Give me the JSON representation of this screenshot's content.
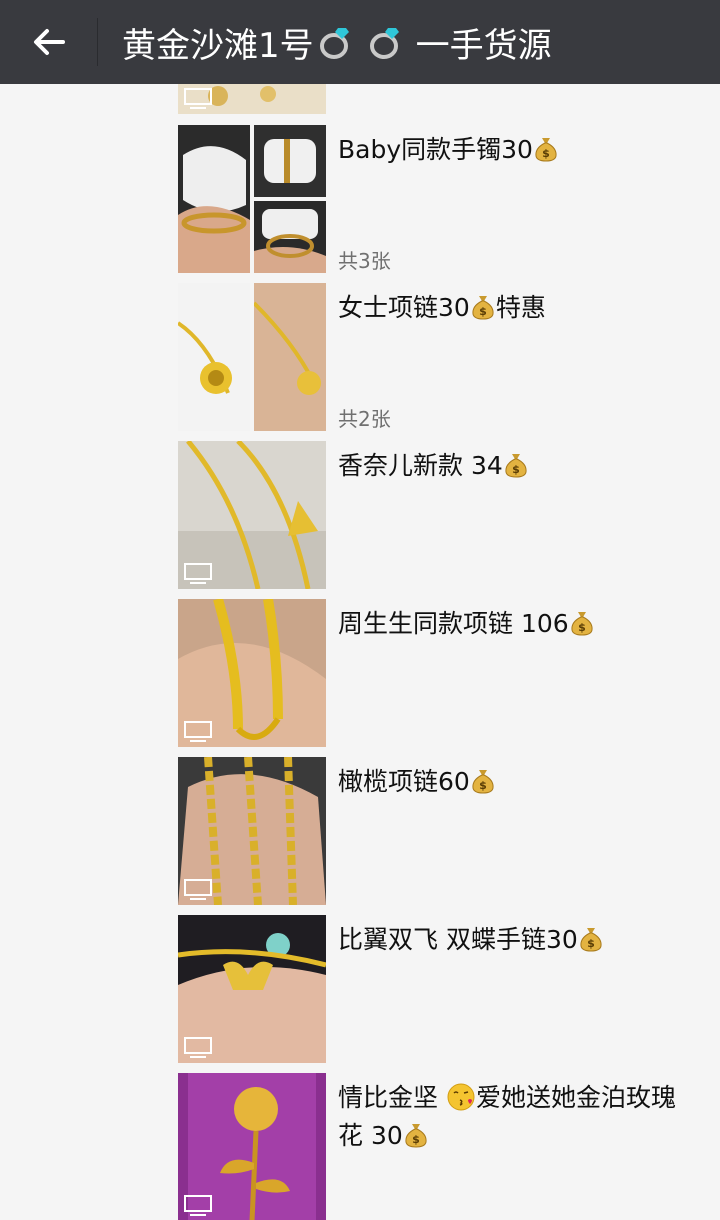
{
  "header": {
    "title_text": "黄金沙滩1号",
    "title_suffix": "一手货源",
    "back_icon": "arrow-left-icon",
    "decor_icon": "ring-icon"
  },
  "posts": [
    {
      "text_before": "",
      "text_after": "",
      "count": ""
    },
    {
      "text_before": "Baby同款手镯30",
      "text_after": "",
      "count": "共3张"
    },
    {
      "text_before": "女士项链30",
      "text_after": "特惠",
      "count": "共2张"
    },
    {
      "text_before": "香奈儿新款 34",
      "text_after": "",
      "count": ""
    },
    {
      "text_before": "周生生同款项链 106",
      "text_after": "",
      "count": ""
    },
    {
      "text_before": "橄榄项链60",
      "text_after": "",
      "count": ""
    },
    {
      "text_before": "比翼双飞 双蝶手链30",
      "text_after": "",
      "count": ""
    },
    {
      "text_before": "情比金坚 ",
      "text_middle": "爱她送她金泊玫瑰花 30",
      "count": ""
    }
  ],
  "colors": {
    "header_bg": "#393a3f",
    "page_bg": "#f5f5f5",
    "gold": "#e6b422",
    "text": "#111111",
    "muted": "#707070"
  },
  "icons": {
    "money_bag": "money-bag-icon",
    "video": "video-icon",
    "kiss": "kissing-face-icon"
  }
}
